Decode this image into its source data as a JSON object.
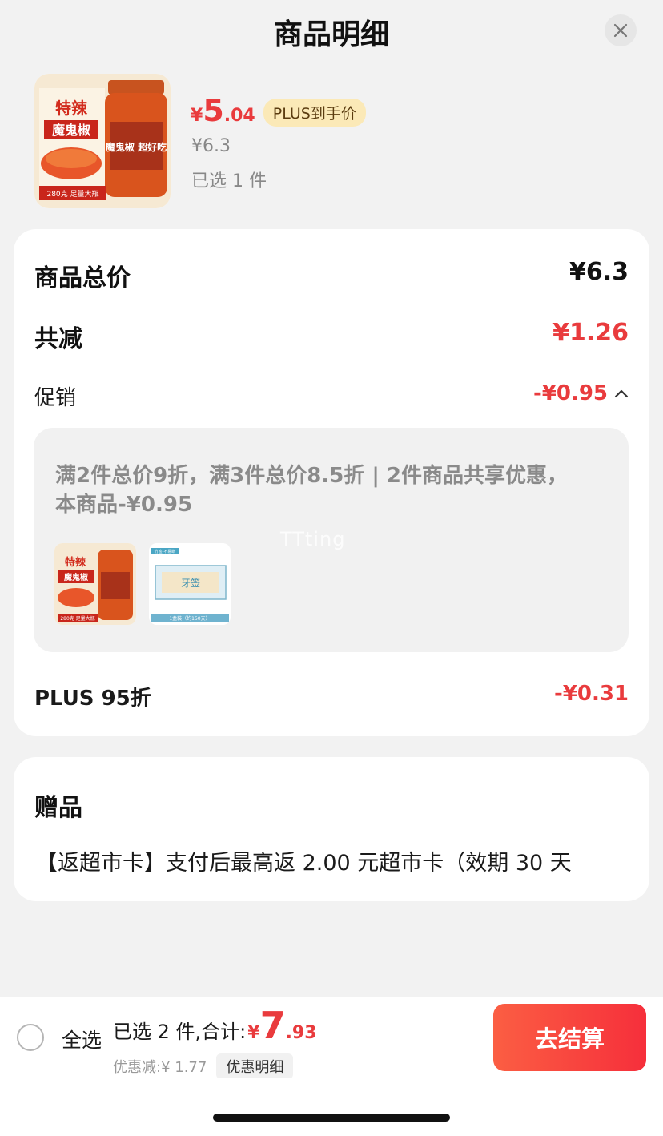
{
  "header": {
    "title": "商品明细",
    "close_icon": "close-icon"
  },
  "product": {
    "price_symbol": "¥",
    "price_int": "5",
    "price_dec": ".04",
    "plus_tag": "PLUS到手价",
    "original_price": "¥6.3",
    "selected": "已选 1 件",
    "image_text": {
      "title": "特辣",
      "subtitle": "魔鬼椒",
      "jar": "魔鬼椒 超好吃",
      "caption": "280克 足量大瓶"
    }
  },
  "price_card": {
    "total_label": "商品总价",
    "total_value": "¥6.3",
    "reduce_label": "共减",
    "reduce_value": "¥1.26",
    "promo_label": "促销",
    "promo_value": "-¥0.95",
    "promo_text": "满2件总价9折，满3件总价8.5折 | 2件商品共享优惠，本商品-¥0.95",
    "watermark": "TTting",
    "promo_items": [
      {
        "title": "特辣",
        "subtitle": "魔鬼椒",
        "caption": "280克 足量大瓶"
      },
      {
        "label": "牙签",
        "caption": "1盒装（约150支）",
        "tag": "竹签 不易断"
      }
    ],
    "plus_label": "PLUS 95折",
    "plus_value": "-¥0.31"
  },
  "gift_card": {
    "title": "赠品",
    "text": "【返超市卡】支付后最高返 2.00 元超市卡（效期 30 天"
  },
  "bottom_bar": {
    "select_all": "全选",
    "selected_total": "已选 2 件,合计:",
    "total_symbol": "¥",
    "total_int": "7",
    "total_dec": ".93",
    "discount_text": "优惠减:¥ 1.77",
    "discount_detail_button": "优惠明细",
    "checkout_button": "去结算"
  },
  "colors": {
    "accent_red": "#e93b3d",
    "plus_gold": "#fbe9b7",
    "checkout_gradient": [
      "#fb5e43",
      "#f62f3b"
    ]
  }
}
